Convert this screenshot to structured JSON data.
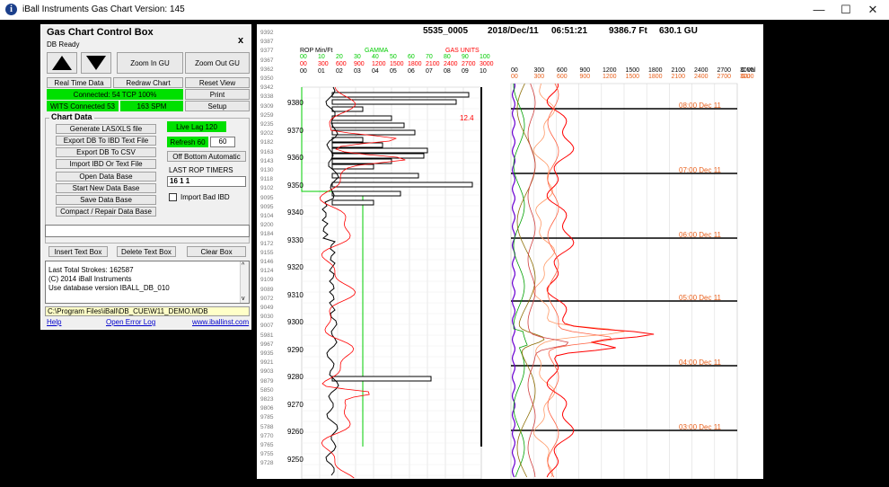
{
  "window": {
    "title": "iBall Instruments Gas Chart  Version: 145",
    "min_glyph": "—",
    "max_glyph": "☐",
    "close_glyph": "✕"
  },
  "control_box": {
    "title": "Gas Chart Control Box",
    "status": "DB Ready",
    "close_glyph": "x",
    "zoom_in": "Zoom In GU",
    "zoom_out": "Zoom Out GU",
    "real_time": "Real Time Data",
    "redraw": "Redraw Chart",
    "reset_view": "Reset View",
    "connected": "Connected: 54 TCP 100%",
    "print": "Print",
    "wits": "WITS Connected 53",
    "spm": "163 SPM",
    "setup": "Setup",
    "chart_data_legend": "Chart Data",
    "generate_las": "Generate LAS/XLS file",
    "export_ibd": "Export DB To IBD Text File",
    "export_csv": "Export DB To CSV",
    "import_ibd": "Import IBD Or Text File",
    "open_db": "Open Data Base",
    "start_db": "Start New Data Base",
    "save_db": "Save Data Base",
    "compact_db": "Compact / Repair Data Base",
    "live_lag": "Live Lag 120",
    "refresh_label": "Refresh 60",
    "refresh_value": "60",
    "off_bottom": "Off Bottom Automatic",
    "last_rop_label": "LAST ROP TIMERS",
    "last_rop_value": "16 1 1",
    "import_bad": "Import Bad IBD",
    "insert_text": "Insert Text Box",
    "delete_text": "Delete Text Box",
    "clear_box": "Clear Box",
    "log_line1": "Last Total Strokes: 162587",
    "log_line2": "(C) 2014 iBall Instruments",
    "log_line3": "Use database version IBALL_DB_010",
    "db_path": "C:\\Program Files\\iBall\\DB_CUE\\W11_DEMO.MDB",
    "help": "Help",
    "open_error_log": "Open Error Log",
    "website": "www.iballinst.com"
  },
  "chart": {
    "header": {
      "well": "5535_0005",
      "date": "2018/Dec/11",
      "time": "06:51:21",
      "depth": "9386.7 Ft",
      "gas": "630.1 GU"
    },
    "rop_label": "ROP Min/Ft",
    "gamma_label": "GAMMA",
    "gas_units_label": "GAS UNITS",
    "gamma_scale": [
      "00",
      "10",
      "20",
      "30",
      "40",
      "50",
      "60",
      "70",
      "80",
      "90",
      "100"
    ],
    "gas_scale": [
      "00",
      "300",
      "600",
      "900",
      "1200",
      "1500",
      "1800",
      "2100",
      "2400",
      "2700",
      "3000"
    ],
    "rop_scale": [
      "00",
      "01",
      "02",
      "03",
      "04",
      "05",
      "06",
      "07",
      "08",
      "09",
      "10"
    ],
    "right_scale_top": [
      "00",
      "300",
      "600",
      "900",
      "1200",
      "1500",
      "1800",
      "2100",
      "2400",
      "2700",
      "3000"
    ],
    "right_scale_bot": [
      "00",
      "300",
      "600",
      "900",
      "1200",
      "1500",
      "1800",
      "2100",
      "2400",
      "2700",
      "3000"
    ],
    "right_c_val": "C Val",
    "right_gu": "GU",
    "rop_value_label": "12.4",
    "depths_small": [
      "9392",
      "9387",
      "9377",
      "9367",
      "9362",
      "9350",
      "9342",
      "9338",
      "9309",
      "9259",
      "9235",
      "9202",
      "9182",
      "9163",
      "9143",
      "9130",
      "9118",
      "9102",
      "9095",
      "9095",
      "9104",
      "9200",
      "9184",
      "9172",
      "9155",
      "9146",
      "9124",
      "9109",
      "9089",
      "9072",
      "9049",
      "9030",
      "9007",
      "5981",
      "9967",
      "9935",
      "9921",
      "9903",
      "9879",
      "5850",
      "9823",
      "9806",
      "9785",
      "5788",
      "9770",
      "9765",
      "9755",
      "9728"
    ],
    "depths_large": [
      "9380",
      "9370",
      "9360",
      "9350",
      "9340",
      "9330",
      "9320",
      "9310",
      "9300",
      "9290",
      "9280",
      "9270",
      "9260",
      "9250"
    ],
    "time_labels": [
      "08:00 Dec 11",
      "07:00 Dec 11",
      "06:00 Dec 11",
      "05:00 Dec 11",
      "04:00 Dec 11",
      "03:00 Dec 11"
    ],
    "colors": {
      "rop": "#000000",
      "gamma": "#00cc00",
      "gas": "#ff0000",
      "time": "#e8601c"
    }
  }
}
